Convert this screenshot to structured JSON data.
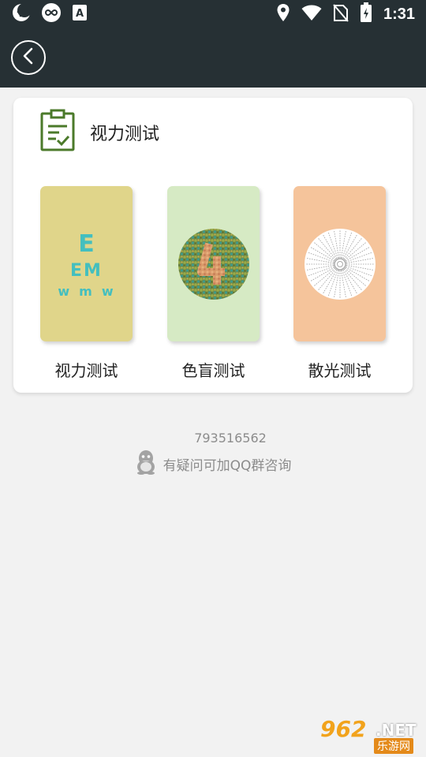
{
  "status_bar": {
    "time": "1:31",
    "left_icons": [
      "moon-icon",
      "link-icon",
      "a-box-icon"
    ],
    "right_icons": [
      "location-icon",
      "wifi-icon",
      "no-sim-icon",
      "battery-icon"
    ]
  },
  "toolbar": {
    "back_icon": "back-arrow-icon"
  },
  "card": {
    "title": "视力测试",
    "header_icon": "clipboard-check-icon",
    "tests": [
      {
        "label": "视力测试",
        "color": "#e0d58a",
        "art": "eye-chart-icon",
        "chart_rows": [
          "E",
          "EM",
          "wmw"
        ]
      },
      {
        "label": "色盲测试",
        "color": "#d6eac4",
        "art": "color-blind-plate-icon"
      },
      {
        "label": "散光测试",
        "color": "#f5c49b",
        "art": "astigmatism-dial-icon"
      }
    ]
  },
  "contact": {
    "number": "793516562",
    "text": "有疑问可加QQ群咨询",
    "icon": "qq-penguin-icon"
  },
  "watermark": {
    "number": "962",
    "suffix": ".NET",
    "site": "乐游网"
  },
  "colors": {
    "bar_bg": "#263034",
    "accent_green": "#4b7a2a",
    "eye_chart": "#44bfbf"
  }
}
